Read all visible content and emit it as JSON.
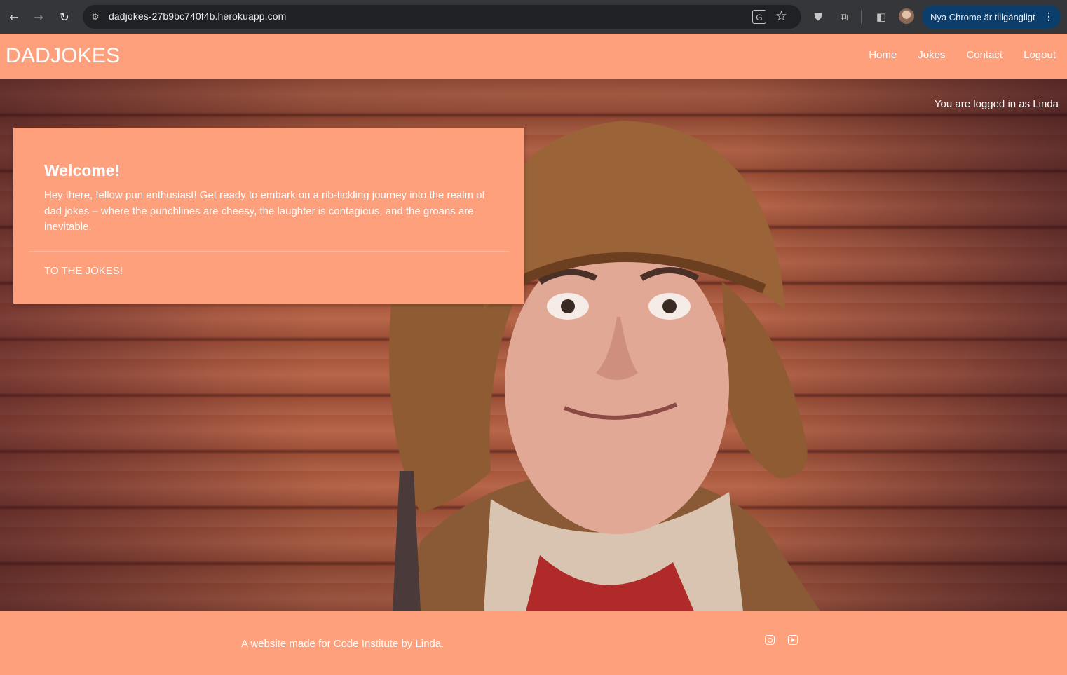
{
  "browser": {
    "url": "dadjokes-27b9bc740f4b.herokuapp.com",
    "update_pill": "Nya Chrome är tillgängligt",
    "icons": {
      "back": "arrow-left-icon",
      "forward": "arrow-right-icon",
      "reload": "reload-icon",
      "site_info": "tune-icon",
      "translate": "translate-icon",
      "bookmark": "star-icon",
      "extension_shield": "shield-icon",
      "extensions": "puzzle-icon",
      "side_panel": "side-panel-icon",
      "menu": "kebab-menu-icon"
    }
  },
  "site": {
    "brand": "DADJOKES",
    "nav": [
      {
        "label": "Home"
      },
      {
        "label": "Jokes"
      },
      {
        "label": "Contact"
      },
      {
        "label": "Logout"
      }
    ],
    "logged_in_text": "You are logged in as Linda",
    "welcome": {
      "title": "Welcome!",
      "text": "Hey there, fellow pun enthusiast! Get ready to embark on a rib-tickling journey into the realm of dad jokes – where the punchlines are cheesy, the laughter is contagious, and the groans are inevitable.",
      "link": "TO THE JOKES!"
    },
    "footer": {
      "text": "A website made for Code Institute by Linda.",
      "social_icons": [
        "instagram-icon",
        "youtube-icon"
      ]
    },
    "colors": {
      "accent": "#ffa07d",
      "text": "#ffffff"
    }
  }
}
